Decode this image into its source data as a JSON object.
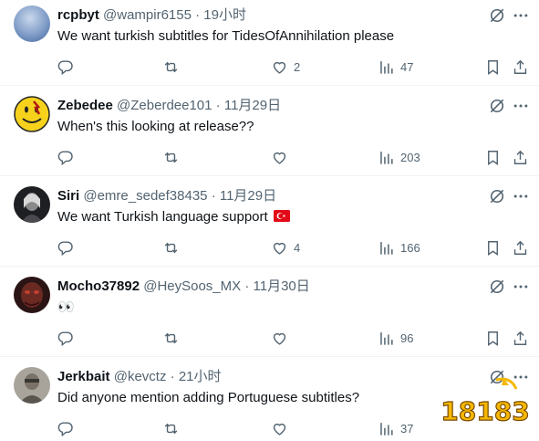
{
  "tweets": [
    {
      "name": "rcpbyt",
      "handle": "@wampir6155",
      "separator": "·",
      "time": "19小时",
      "text": "We want turkish subtitles for TidesOfAnnihilation please",
      "reply_count": "",
      "retweet_count": "",
      "like_count": "2",
      "view_count": "47",
      "avatar_style": "blue-gradient"
    },
    {
      "name": "Zebedee",
      "handle": "@Zeberdee101",
      "separator": "·",
      "time": "11月29日",
      "text": "When's this looking at release??",
      "reply_count": "",
      "retweet_count": "",
      "like_count": "",
      "view_count": "203",
      "avatar_style": "watchmen-smiley"
    },
    {
      "name": "Siri",
      "handle": "@emre_sedef38435",
      "separator": "·",
      "time": "11月29日",
      "text": "We want Turkish language support",
      "flag": "turkey-flag",
      "reply_count": "",
      "retweet_count": "",
      "like_count": "4",
      "view_count": "166",
      "avatar_style": "dark-portrait"
    },
    {
      "name": "Mocho37892",
      "handle": "@HeySoos_MX",
      "separator": "·",
      "time": "11月30日",
      "text": "👀",
      "reply_count": "",
      "retweet_count": "",
      "like_count": "",
      "view_count": "96",
      "avatar_style": "red-dark"
    },
    {
      "name": "Jerkbait",
      "handle": "@kevctz",
      "separator": "·",
      "time": "21小时",
      "text": "Did anyone mention adding Portuguese subtitles?",
      "reply_count": "",
      "retweet_count": "",
      "like_count": "",
      "view_count": "37",
      "avatar_style": "grey-photo"
    }
  ],
  "icons": {
    "grok": "grok-icon",
    "more": "more-icon",
    "reply": "reply-icon",
    "retweet": "retweet-icon",
    "like": "like-icon",
    "views": "views-icon",
    "bookmark": "bookmark-icon",
    "share": "share-icon"
  },
  "watermark": {
    "text": "18183"
  },
  "colors": {
    "text": "#0f1419",
    "secondary": "#536471",
    "divider": "#eff3f4",
    "flag_red": "#e30a17",
    "watermark_yellow": "#f5b800"
  }
}
